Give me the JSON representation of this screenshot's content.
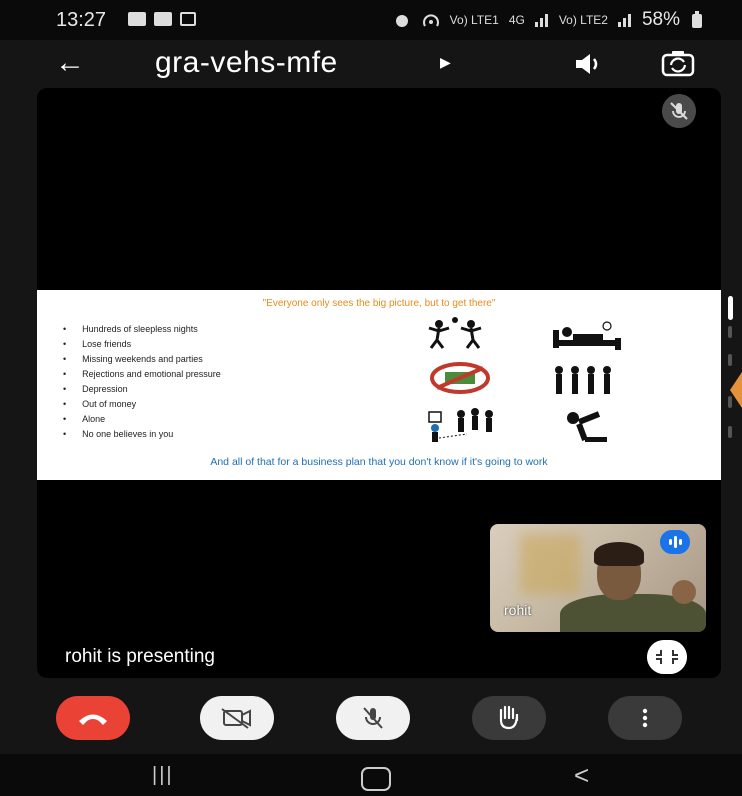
{
  "status_bar": {
    "time": "13:27",
    "network_labels": [
      "Vo) LTE1",
      "4G",
      "Vo) LTE2"
    ],
    "battery": "58%"
  },
  "app_bar": {
    "meeting_code": "gra-vehs-mfe",
    "back_icon": "arrow-left-icon",
    "speaker_icon": "speaker-icon",
    "camera_switch_icon": "camera-switch-icon"
  },
  "slide": {
    "quote": "\"Everyone only sees the big picture, but to get there\"",
    "bullets": [
      "Hundreds of sleepless nights",
      "Lose friends",
      "Missing weekends and parties",
      "Rejections and emotional pressure",
      "Depression",
      "Out of money",
      "Alone",
      "No one believes in you"
    ],
    "footer": "And all of that for a business plan that you don't know if it's going to work"
  },
  "self_view": {
    "name": "rohit"
  },
  "presenting_text": "rohit is presenting",
  "controls": {
    "end_call_icon": "phone-hangup-icon",
    "camera_icon": "camera-off-icon",
    "mic_icon": "mic-off-icon",
    "raise_hand_icon": "hand-icon",
    "more_icon": "more-vertical-icon"
  },
  "colors": {
    "end_call": "#ea4335",
    "quote": "#e98a1c",
    "footer": "#1f6fb0",
    "audio_badge": "#1a73e8"
  }
}
